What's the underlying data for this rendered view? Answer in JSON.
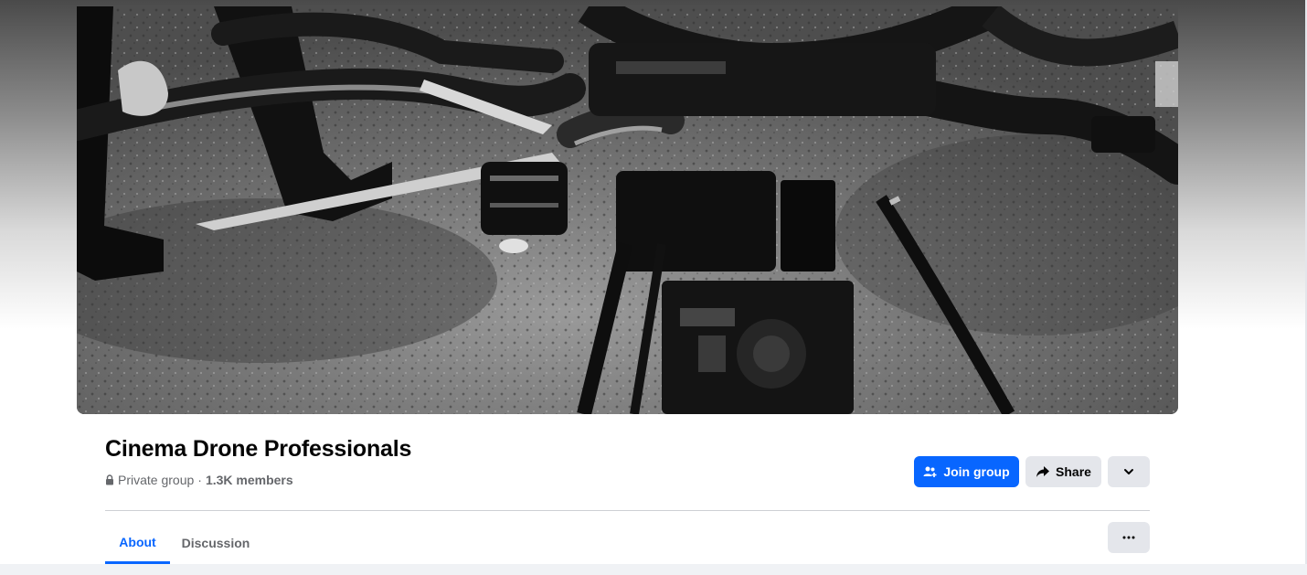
{
  "group": {
    "name": "Cinema Drone Professionals",
    "privacy": "Private group",
    "separator": "·",
    "members": "1.3K members"
  },
  "actions": {
    "join_label": "Join group",
    "share_label": "Share"
  },
  "tabs": [
    {
      "label": "About",
      "active": true
    },
    {
      "label": "Discussion",
      "active": false
    }
  ],
  "icons": {
    "lock": "lock-icon",
    "join": "people-add-icon",
    "share": "share-arrow-icon",
    "dropdown": "chevron-down-icon",
    "more": "more-dots-icon"
  },
  "colors": {
    "accent": "#0866ff",
    "button_gray": "#e4e6eb",
    "text_primary": "#050505",
    "text_secondary": "#65676b"
  }
}
